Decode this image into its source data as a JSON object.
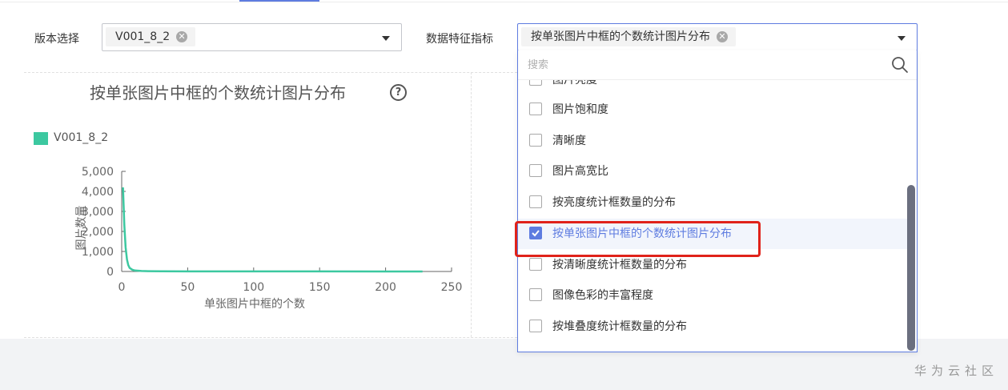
{
  "filters": {
    "version_label": "版本选择",
    "version_tag": "V001_8_2",
    "feature_label": "数据特征指标",
    "feature_tag": "按单张图片中框的个数统计图片分布"
  },
  "chart": {
    "title": "按单张图片中框的个数统计图片分布",
    "help_glyph": "?"
  },
  "chart_data": {
    "type": "line",
    "title": "按单张图片中框的个数统计图片分布",
    "xlabel": "单张图片中框的个数",
    "ylabel": "图片数量",
    "xlim": [
      0,
      250
    ],
    "ylim": [
      0,
      5000
    ],
    "x_ticks": [
      "0",
      "50",
      "100",
      "150",
      "200",
      "250"
    ],
    "y_ticks": [
      "0",
      "1,000",
      "2,000",
      "3,000",
      "4,000",
      "5,000"
    ],
    "legend_position": "top-left",
    "grid": false,
    "series": [
      {
        "name": "V001_8_2",
        "color": "#3cc8a0",
        "x": [
          1,
          2,
          3,
          4,
          5,
          6,
          8,
          10,
          15,
          20,
          30,
          50,
          100,
          150,
          200,
          228
        ],
        "y": [
          4200,
          2300,
          1200,
          600,
          320,
          180,
          90,
          50,
          25,
          15,
          8,
          5,
          3,
          2,
          1,
          1
        ]
      }
    ]
  },
  "dropdown": {
    "search_placeholder": "搜索",
    "options": [
      {
        "label": "图片亮度",
        "checked": false
      },
      {
        "label": "图片饱和度",
        "checked": false
      },
      {
        "label": "清晰度",
        "checked": false
      },
      {
        "label": "图片高宽比",
        "checked": false
      },
      {
        "label": "按亮度统计框数量的分布",
        "checked": false
      },
      {
        "label": "按单张图片中框的个数统计图片分布",
        "checked": true
      },
      {
        "label": "按清晰度统计框数量的分布",
        "checked": false
      },
      {
        "label": "图像色彩的丰富程度",
        "checked": false
      },
      {
        "label": "按堆叠度统计框数量的分布",
        "checked": false
      }
    ]
  },
  "footer": {
    "brand": "华为云社区"
  },
  "colors": {
    "accent": "#5e7ce0",
    "series": "#3cc8a0",
    "highlight": "#e0221a"
  }
}
